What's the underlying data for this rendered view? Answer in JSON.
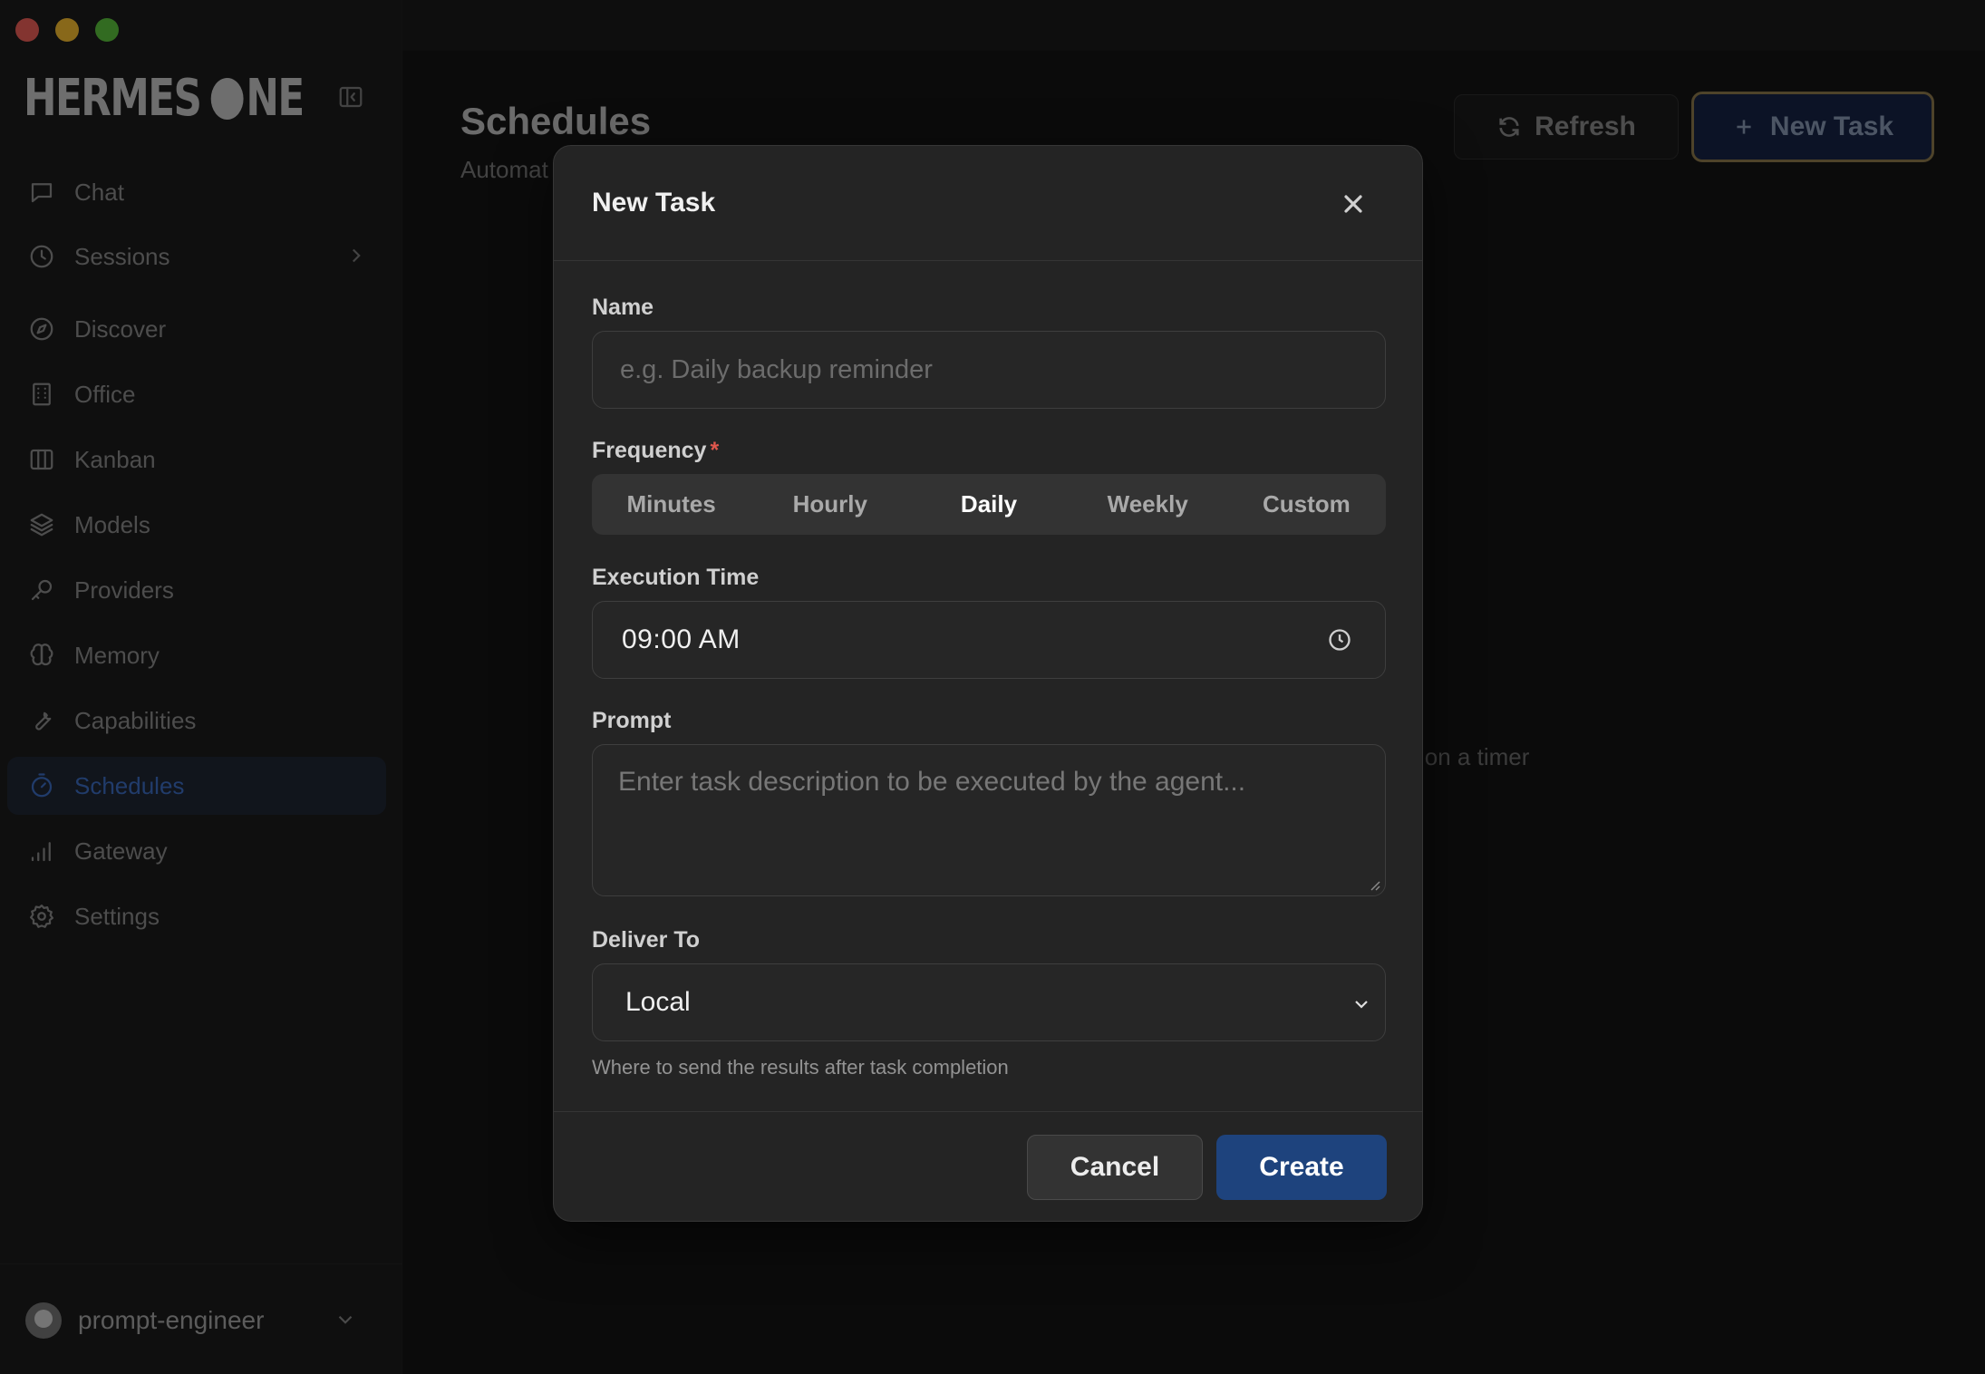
{
  "app": {
    "brand_left": "HERMES",
    "brand_right": "NE"
  },
  "sidebar": {
    "items": [
      {
        "label": "Chat",
        "icon": "chat-icon"
      },
      {
        "label": "Sessions",
        "icon": "clock-icon"
      },
      {
        "label": "Discover",
        "icon": "compass-icon"
      },
      {
        "label": "Office",
        "icon": "building-icon"
      },
      {
        "label": "Kanban",
        "icon": "kanban-icon"
      },
      {
        "label": "Models",
        "icon": "layers-icon"
      },
      {
        "label": "Providers",
        "icon": "key-icon"
      },
      {
        "label": "Memory",
        "icon": "brain-icon"
      },
      {
        "label": "Capabilities",
        "icon": "wrench-icon"
      },
      {
        "label": "Schedules",
        "icon": "timer-icon",
        "active": true
      },
      {
        "label": "Gateway",
        "icon": "signal-icon"
      },
      {
        "label": "Settings",
        "icon": "gear-icon"
      }
    ],
    "user": {
      "name": "prompt-engineer"
    }
  },
  "main": {
    "title": "Schedules",
    "subtitle": "Automat",
    "empty_text": "lly on a timer",
    "refresh_label": "Refresh",
    "new_task_label": "New Task"
  },
  "modal": {
    "title": "New Task",
    "name_label": "Name",
    "name_placeholder": "e.g. Daily backup reminder",
    "frequency_label": "Frequency",
    "frequency_required_mark": "*",
    "frequency_options": [
      "Minutes",
      "Hourly",
      "Daily",
      "Weekly",
      "Custom"
    ],
    "frequency_selected": "Daily",
    "execution_time_label": "Execution Time",
    "execution_time_value": "09:00 AM",
    "prompt_label": "Prompt",
    "prompt_placeholder": "Enter task description to be executed by the agent...",
    "deliver_label": "Deliver To",
    "deliver_value": "Local",
    "deliver_hint": "Where to send the results after task completion",
    "cancel_label": "Cancel",
    "create_label": "Create"
  },
  "colors": {
    "accent": "#3d6dc4",
    "primary_button": "#1e437d",
    "required": "#e0574d",
    "focus_ring": "#8e7a4e"
  }
}
